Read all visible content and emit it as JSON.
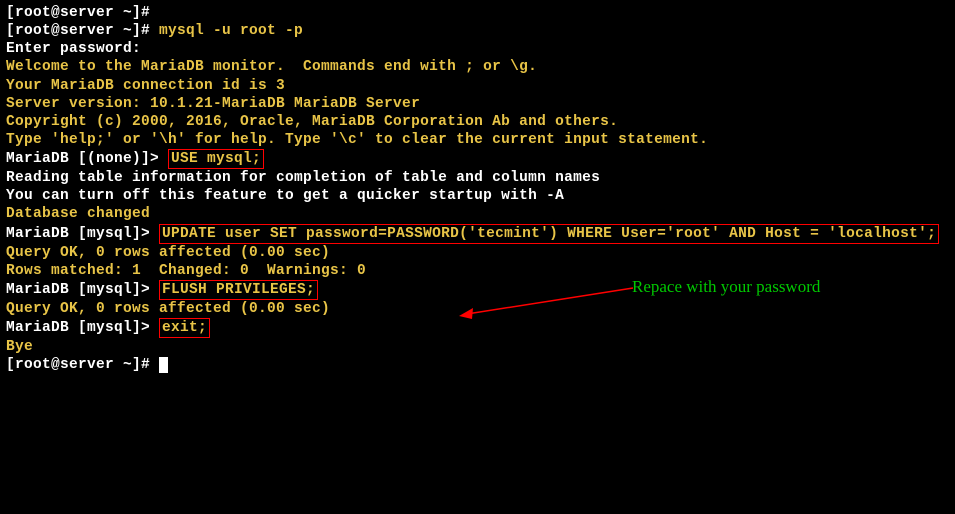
{
  "lines": {
    "l1": "[root@server ~]# ",
    "l2p": "[root@server ~]# ",
    "l2c": "mysql -u root -p",
    "l3": "Enter password: ",
    "l4": "Welcome to the MariaDB monitor.  Commands end with ; or \\g.",
    "l5": "Your MariaDB connection id is 3",
    "l6": "Server version: 10.1.21-MariaDB MariaDB Server",
    "l7": "",
    "l8": "Copyright (c) 2000, 2016, Oracle, MariaDB Corporation Ab and others.",
    "l9": "",
    "l10": "Type 'help;' or '\\h' for help. Type '\\c' to clear the current input statement.",
    "l11": "",
    "l12p": "MariaDB [(none)]> ",
    "l12c": "USE mysql;",
    "l13": "Reading table information for completion of table and column names",
    "l14": "You can turn off this feature to get a quicker startup with -A",
    "l15": "",
    "l16": "Database changed",
    "l17p": "MariaDB [mysql]> ",
    "l17c": "UPDATE user SET password=PASSWORD('tecmint') WHERE User='root' AND Host = 'localhost';",
    "l18": "Query OK, 0 rows affected (0.00 sec)",
    "l19": "Rows matched: 1  Changed: 0  Warnings: 0",
    "l20": "",
    "l21p": "MariaDB [mysql]> ",
    "l21c": "FLUSH PRIVILEGES;",
    "l22": "Query OK, 0 rows affected (0.00 sec)",
    "l23": "",
    "l24p": "MariaDB [mysql]> ",
    "l24c": "exit;",
    "l25": "Bye",
    "l26": "[root@server ~]# "
  },
  "annotation": {
    "text": "Repace with your password"
  }
}
